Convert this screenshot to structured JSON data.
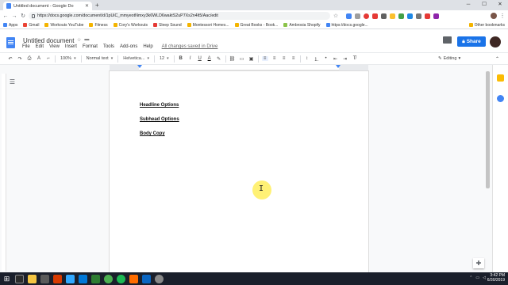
{
  "browser": {
    "tab_title": "Untitled document - Google Do",
    "new_tab_icon": "plus-icon",
    "url": "https://docs.google.com/document/d/1pUiC_mmyeotNmxy3k6WLD6waktS2uP7Xs2n4lt5/Aac/edit",
    "bookmarks": [
      {
        "label": "Apps",
        "color": "#4285f4"
      },
      {
        "label": "Gmail",
        "color": "#ea4335"
      },
      {
        "label": "Workouts YouTube",
        "color": "#f4b400"
      },
      {
        "label": "Fitness",
        "color": "#f4b400"
      },
      {
        "label": "Cory's Workouts",
        "color": "#f4b400"
      },
      {
        "label": "Sleep Sound",
        "color": "#e53935"
      },
      {
        "label": "Montessori Homes...",
        "color": "#f4b400"
      },
      {
        "label": "Great Books - Book...",
        "color": "#f4b400"
      },
      {
        "label": "Ambrosia Shopify",
        "color": "#8bc34a"
      },
      {
        "label": "https://docs.google...",
        "color": "#4285f4"
      }
    ],
    "other_bookmarks": "Other bookmarks"
  },
  "docs": {
    "title": "Untitled document",
    "menus": [
      "File",
      "Edit",
      "View",
      "Insert",
      "Format",
      "Tools",
      "Add-ons",
      "Help"
    ],
    "saved_status": "All changes saved in Drive",
    "share_label": "Share",
    "toolbar": {
      "zoom": "100%",
      "style": "Normal text",
      "font": "Helvetica...",
      "size": "12",
      "mode": "Editing"
    }
  },
  "document": {
    "lines": [
      "Headline Options",
      "Subhead Options",
      "Body Copy"
    ]
  },
  "taskbar": {
    "time": "3:42 PM",
    "date": "6/30/2019"
  },
  "colors": {
    "share_blue": "#1a73e8",
    "docs_blue": "#4285f4"
  }
}
